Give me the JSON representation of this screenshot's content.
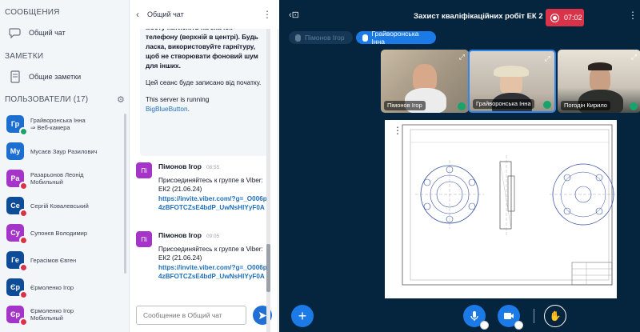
{
  "sidebar": {
    "messages_title": "СООБЩЕНИЯ",
    "public_chat": "Общий чат",
    "notes_title": "ЗАМЕТКИ",
    "shared_notes": "Общие заметки",
    "users_title": "ПОЛЬЗОВАТЕЛИ (17)",
    "users": [
      {
        "initials": "Гр",
        "name": "Грайворонська Інна",
        "sub": "⇒ Веб-камера",
        "color": "#1c6fd0",
        "mic": "#17a36b",
        "cam": true
      },
      {
        "initials": "Му",
        "name": "Мусаєв Заур Разилович",
        "sub": "",
        "color": "#1c6fd0",
        "mic": "",
        "cam": true
      },
      {
        "initials": "Ра",
        "name": "Разарьонов Леонід",
        "sub": "Мобильный",
        "color": "#a435c8",
        "mic": "#d9334a",
        "cam": false
      },
      {
        "initials": "Се",
        "name": "Сергій Ковалевський",
        "sub": "",
        "color": "#0f4c97",
        "mic": "#d9334a",
        "cam": false
      },
      {
        "initials": "Су",
        "name": "Супонєв Володимир",
        "sub": "",
        "color": "#a435c8",
        "mic": "#d9334a",
        "cam": false
      },
      {
        "initials": "Ге",
        "name": "Герасімов Євген",
        "sub": "",
        "color": "#0f4c97",
        "mic": "#d9334a",
        "cam": false
      },
      {
        "initials": "Єр",
        "name": "Єрмоленко Ігор",
        "sub": "",
        "color": "#0f4c97",
        "mic": "#d9334a",
        "cam": false
      },
      {
        "initials": "Єр",
        "name": "Єрмоленко Ігор",
        "sub": "Мобильный",
        "color": "#a435c8",
        "mic": "#d9334a",
        "cam": false
      }
    ]
  },
  "chat": {
    "title": "Общий чат",
    "welcome_line1": "мосту натисніть на значок телефону (верхній в центрі). Будь ласка, використовуйте гарнітуру, щоб не створювати фоновий шум для інших.",
    "welcome_line2": "Цей сеанс буде записано від початку.",
    "welcome_line3": "This server is running",
    "welcome_link": "BigBlueButton",
    "welcome_dot": ".",
    "messages": [
      {
        "initials": "Пі",
        "author": "Пімонов Ігор",
        "time": "08:55",
        "text": "Присоединяйтесь к группе в Viber: ЕК2 (21.06.24)",
        "link": "https://invite.viber.com/?g=_O006p4zBFOTCZsE4bdP_UwNsHlYyF0A"
      },
      {
        "initials": "Пі",
        "author": "Пімонов Ігор",
        "time": "09:05",
        "text": "Присоединяйтесь к группе в Viber: ЕК2 (21.06.24)",
        "link": "https://invite.viber.com/?g=_O006p4zBFOTCZsE4bdP_UwNsHlYyF0A"
      }
    ],
    "input_placeholder": "Сообщение в Общий чат"
  },
  "meeting": {
    "title": "Захист кваліфікаційних робіт ЕК 2",
    "recording_time": "07:02",
    "talkers": [
      {
        "name": "Пімонов Ігор",
        "active": false
      },
      {
        "name": "Грайворонська Інна",
        "active": true
      }
    ],
    "videos": [
      {
        "name": "Пімонов Ігор"
      },
      {
        "name": "Грайворонська Інна"
      },
      {
        "name": "Погодін Кирило"
      }
    ],
    "colors": {
      "background": "#05243d",
      "primary": "#1b7ae5",
      "recording": "#d9334a"
    }
  }
}
